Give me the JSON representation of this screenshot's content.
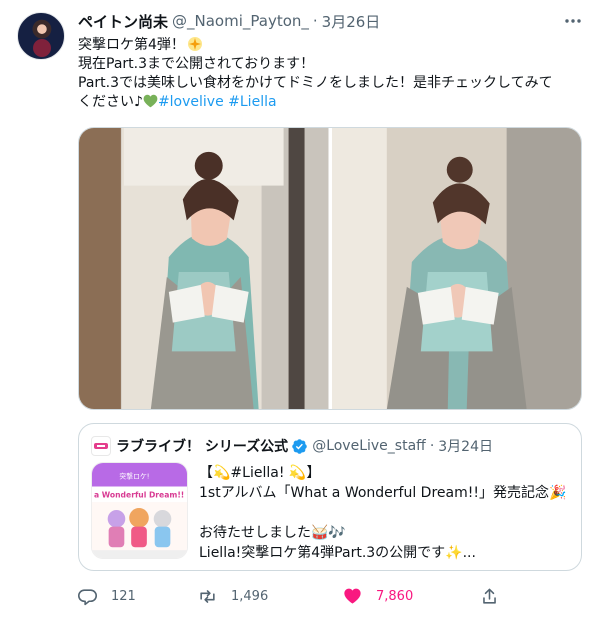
{
  "tweet": {
    "author_name": "ペイトン尚未",
    "handle": "@_Naomi_Payton_",
    "separator": "·",
    "date": "3月26日",
    "line1": "突撃ロケ第4弾！",
    "line2": "現在Part.3まで公開されております！",
    "line3": "Part.3では美味しい食材をかけてドミノをしました！是非チェックしてみて",
    "line4_prefix": "ください♪",
    "hashtag1": "#lovelive",
    "hashtag2": "#Liella"
  },
  "quote": {
    "author_name": "ラブライブ！ シリーズ公式",
    "handle": "@LoveLive_staff",
    "separator": "·",
    "date": "3月24日",
    "line1": "【💫#Liella! 💫】",
    "line2": "1stアルバム「What a Wonderful Dream!!」発売記念🎉",
    "line3": "",
    "line4": "お待たせしました🥁🎶",
    "line5": "Liella!突撃ロケ第4弾Part.3の公開です✨...",
    "thumbnail_text": "a Wonderful Dream!!",
    "thumbnail_top_text": "突撃ロケ!"
  },
  "actions": {
    "replies": "121",
    "retweets": "1,496",
    "likes": "7,860"
  },
  "colors": {
    "accent": "#1d9bf0",
    "like": "#f91880",
    "muted": "#536471",
    "text": "#0f1419",
    "border": "#cfd9de"
  }
}
